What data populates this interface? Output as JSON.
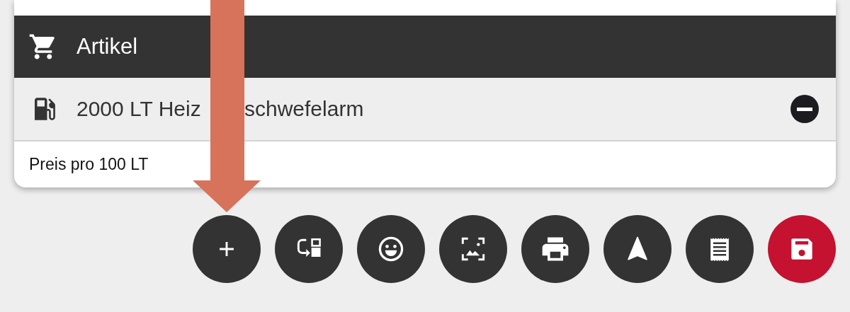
{
  "section": {
    "title": "Artikel"
  },
  "item": {
    "name_parts": [
      "2000 LT Heiz",
      "schwefelarm"
    ]
  },
  "detail": {
    "label": "Preis pro 100 LT"
  },
  "actions": [
    {
      "kind": "add",
      "color": "#333333"
    },
    {
      "kind": "swap",
      "color": "#333333"
    },
    {
      "kind": "emoji",
      "color": "#333333"
    },
    {
      "kind": "image",
      "color": "#333333"
    },
    {
      "kind": "print",
      "color": "#333333"
    },
    {
      "kind": "navigate",
      "color": "#333333"
    },
    {
      "kind": "receipt",
      "color": "#333333"
    },
    {
      "kind": "save",
      "color": "#c41230"
    }
  ]
}
